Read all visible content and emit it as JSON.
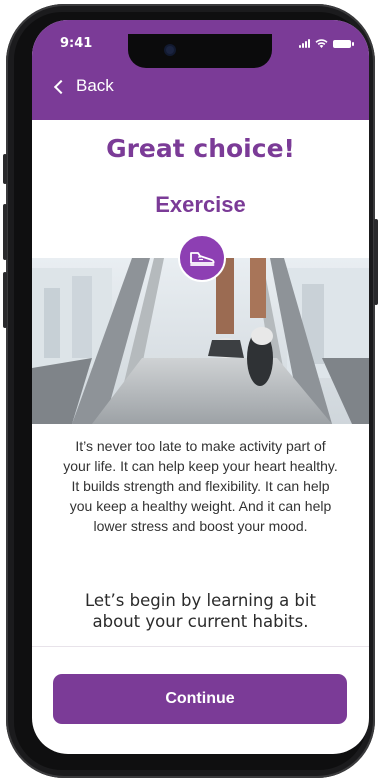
{
  "status_bar": {
    "time": "9:41"
  },
  "header": {
    "back_label": "Back"
  },
  "main": {
    "title": "Great choice!",
    "subtitle": "Exercise",
    "badge_icon": "sneaker-icon",
    "description": "It’s never too late to make activity part of your life. It can help keep your heart healthy. It builds strength and flexibility. It can help you keep a healthy weight. And it can help lower stress and boost your mood.",
    "prompt": "Let’s begin by learning a bit about your current habits."
  },
  "footer": {
    "continue_label": "Continue"
  },
  "colors": {
    "accent": "#7b3b97",
    "badge": "#8d3fb3",
    "frame": "#1b1b1d"
  }
}
